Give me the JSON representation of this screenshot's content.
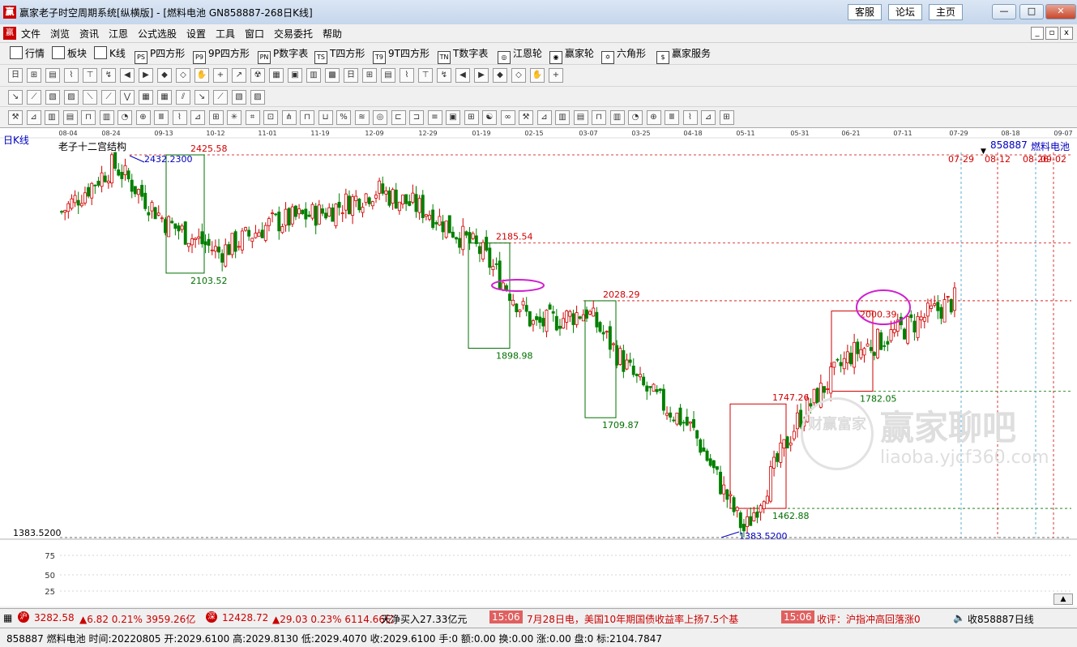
{
  "window": {
    "title": "赢家老子时空周期系统[纵横版] - [燃料电池  GN858887-268日K线]",
    "links": [
      "客服",
      "论坛",
      "主页"
    ],
    "controls": [
      "—",
      "□",
      "✕"
    ]
  },
  "menu": {
    "items": [
      "文件",
      "浏览",
      "资讯",
      "江恩",
      "公式选股",
      "设置",
      "工具",
      "窗口",
      "交易委托",
      "帮助"
    ]
  },
  "toolbar1": {
    "items": [
      {
        "label": "行情",
        "icon": "grid-icon"
      },
      {
        "label": "板块",
        "icon": "blocks-icon"
      },
      {
        "label": "K线",
        "icon": "candle-icon"
      },
      {
        "label": "P四方形",
        "icon": "ps-icon",
        "badge": "PS"
      },
      {
        "label": "9P四方形",
        "icon": "p9-icon",
        "badge": "P9"
      },
      {
        "label": "P数字表",
        "icon": "pn-icon",
        "badge": "PN"
      },
      {
        "label": "T四方形",
        "icon": "ts-icon",
        "badge": "TS"
      },
      {
        "label": "9T四方形",
        "icon": "t9-icon",
        "badge": "T9"
      },
      {
        "label": "T数字表",
        "icon": "tn-icon",
        "badge": "TN"
      },
      {
        "label": "江恩轮",
        "icon": "wheel-icon",
        "badge": "◎"
      },
      {
        "label": "赢家轮",
        "icon": "winner-wheel-icon",
        "badge": "◉"
      },
      {
        "label": "六角形",
        "icon": "hexagon-icon",
        "badge": "✡"
      },
      {
        "label": "赢家服务",
        "icon": "dollar-icon",
        "badge": "$"
      }
    ]
  },
  "chart": {
    "period_label": "日K线",
    "structure_label": "老子十二宫结构",
    "code_label": "858887",
    "name_label": "燃料电池",
    "min_axis_label": "1383.5200",
    "date_ticks": [
      "08-04",
      "08-24",
      "09-13",
      "10-12",
      "11-01",
      "11-19",
      "12-09",
      "12-29",
      "01-19",
      "02-15",
      "03-07",
      "03-25",
      "04-18",
      "05-11",
      "05-31",
      "06-21",
      "07-11",
      "07-29",
      "08-18",
      "09-07"
    ],
    "future_dates": [
      "07-29",
      "08-12",
      "08-26",
      "09-02"
    ],
    "lower_axis": [
      "75",
      "50",
      "25"
    ],
    "price_annotations": [
      {
        "text": "2425.58",
        "color": "#d00000"
      },
      {
        "text": "2432.2300",
        "color": "#0000c0"
      },
      {
        "text": "2103.52",
        "color": "#007000"
      },
      {
        "text": "2185.54",
        "color": "#d00000"
      },
      {
        "text": "1898.98",
        "color": "#007000"
      },
      {
        "text": "2028.29",
        "color": "#d00000"
      },
      {
        "text": "1709.87",
        "color": "#007000"
      },
      {
        "text": "1747.26",
        "color": "#d00000"
      },
      {
        "text": "1462.88",
        "color": "#007000"
      },
      {
        "text": "1383.5200",
        "color": "#0000c0"
      },
      {
        "text": "2000.39",
        "color": "#d00000"
      },
      {
        "text": "1782.05",
        "color": "#007000"
      }
    ]
  },
  "watermark": {
    "brand": "赢家聊吧",
    "url": "liaoba.yjcf360.com",
    "seal": "财赢富家"
  },
  "ticker": {
    "sh_index": "3282.58",
    "sh_change": "▲6.82 0.21% 3959.26亿",
    "sz_index": "12428.72",
    "sz_change": "▲29.03 0.23% 6114.66亿",
    "scroll1": "天净买入27.33亿元",
    "time1": "15:06",
    "news1": "7月28日电，美国10年期国债收益率上扬7.5个基",
    "time2": "15:06",
    "news2": "收评：沪指冲高回落涨0",
    "right_label": "收858887日线"
  },
  "status": {
    "text": "858887 燃料电池 时间:20220805 开:2029.6100 高:2029.8130 低:2029.4070 收:2029.6100 手:0 额:0.00 换:0.00 涨:0.00 盘:0 标:2104.7847"
  },
  "chart_data": {
    "type": "candlestick",
    "x": [
      "08-04",
      "08-24",
      "09-13",
      "10-12",
      "11-01",
      "11-19",
      "12-09",
      "12-29",
      "01-19",
      "02-15",
      "03-07",
      "03-25",
      "04-18",
      "05-11",
      "05-31",
      "06-21",
      "07-11",
      "07-29"
    ],
    "close": [
      2270,
      2400,
      2240,
      2160,
      2240,
      2270,
      2330,
      2270,
      2160,
      1960,
      2000,
      1800,
      1680,
      1400,
      1700,
      1880,
      1950,
      2029.61
    ],
    "levels": [
      2425.58,
      2185.54,
      2028.29,
      1782.05,
      1462.88,
      1383.52
    ],
    "boxes": [
      {
        "high": 2425.58,
        "low": 2103.52,
        "color": "green"
      },
      {
        "high": 2185.54,
        "low": 1898.98,
        "color": "green"
      },
      {
        "high": 2028.29,
        "low": 1709.87,
        "color": "green"
      },
      {
        "high": 1747.26,
        "low": 1462.88,
        "color": "red"
      },
      {
        "high": 2000.39,
        "low": 1782.05,
        "color": "red"
      }
    ],
    "ylim": [
      1383.52,
      2432.23
    ]
  }
}
